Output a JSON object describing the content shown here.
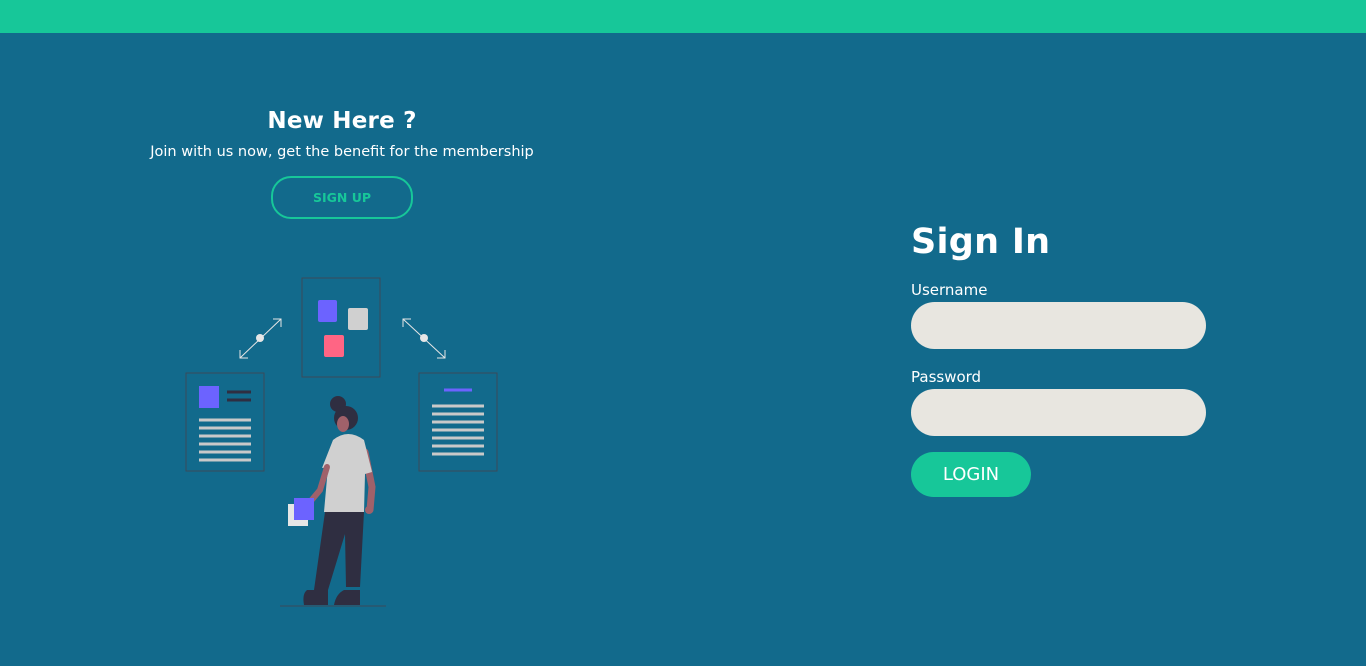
{
  "colors": {
    "background": "#126a8c",
    "accent": "#17c799",
    "input_background": "#e8e6e0",
    "illustration_purple": "#6c63ff",
    "illustration_pink": "#ff6584"
  },
  "promo": {
    "title": "New Here ?",
    "subtitle": "Join with us now, get the benefit for the membership",
    "signup_label": "SIGN UP"
  },
  "illustration": {
    "icon": "person-with-documents-illustration"
  },
  "login": {
    "title": "Sign In",
    "username_label": "Username",
    "username_value": "",
    "password_label": "Password",
    "password_value": "",
    "login_label": "LOGIN"
  }
}
